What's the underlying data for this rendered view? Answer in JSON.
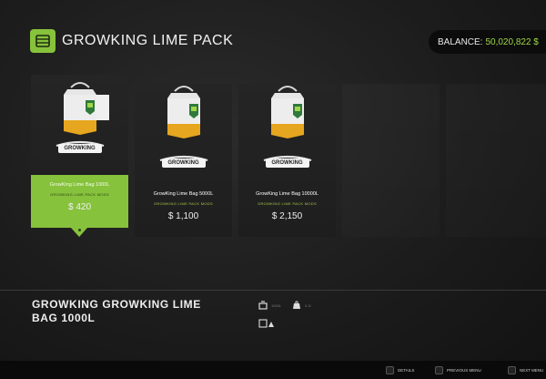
{
  "header": {
    "title": "GROWKING LIME PACK",
    "icon": "storage-bag-icon",
    "accent": "#86c23c"
  },
  "balance": {
    "label": "BALANCE:",
    "value": "50,020,822 $"
  },
  "products": [
    {
      "name": "GrowKing Lime Bag 1000L",
      "subtitle": "GROWKING LIME PACK MODS",
      "price": "$ 420",
      "brand": "GROWKING",
      "selected": true
    },
    {
      "name": "GrowKing Lime Bag 5000L",
      "subtitle": "GROWKING LIME PACK MODS",
      "price": "$ 1,100",
      "brand": "GROWKING",
      "selected": false
    },
    {
      "name": "GrowKing Lime Bag 10000L",
      "subtitle": "GROWKING LIME PACK MODS",
      "price": "$ 2,150",
      "brand": "GROWKING",
      "selected": false
    }
  ],
  "details": {
    "title": "GROWKING GROWKING LIME BAG 1000L",
    "specs": [
      {
        "icon": "capacity-icon",
        "text": "1000L"
      },
      {
        "icon": "weight-icon",
        "text": "0.1t"
      },
      {
        "icon": "fill-type-icon",
        "text": ""
      }
    ]
  },
  "footer": {
    "hints": [
      {
        "key": "Q",
        "label": "DETAILS"
      },
      {
        "key": "B",
        "label": "PREVIOUS MENU"
      },
      {
        "key": "E",
        "label": "NEXT MENU"
      }
    ]
  }
}
